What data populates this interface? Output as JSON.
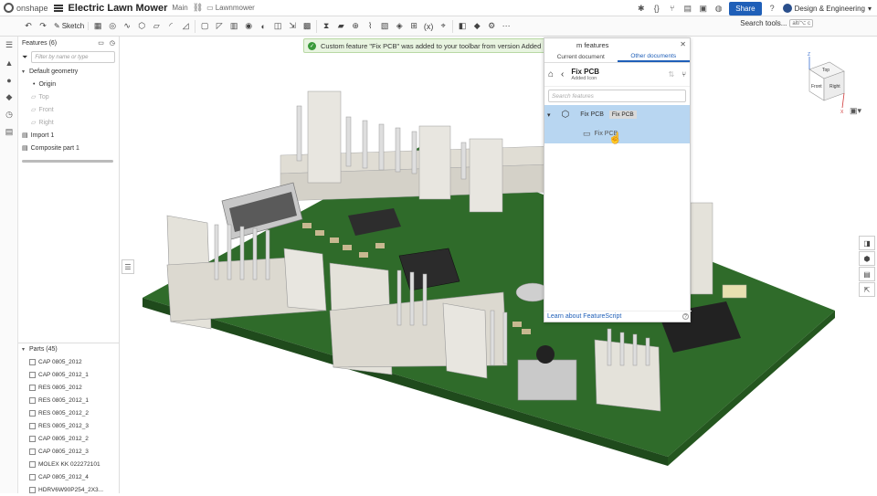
{
  "app": {
    "brand": "onshape",
    "doc_title": "Electric Lawn Mower",
    "branch": "Main",
    "folder": "Lawnmower"
  },
  "topright": {
    "share_label": "Share",
    "user_label": "Design & Engineering"
  },
  "toolbar": {
    "sketch_label": "Sketch",
    "search_label": "Search tools...",
    "search_shortcut": "alt/⌥ c"
  },
  "features": {
    "header": "Features (6)",
    "filter_placeholder": "Filter by name or type",
    "default_geometry": "Default geometry",
    "items": [
      "Origin",
      "Top",
      "Front",
      "Right"
    ],
    "import": "Import 1",
    "composite": "Composite part 1"
  },
  "parts": {
    "header": "Parts (45)",
    "items": [
      "CAP 0805_2012",
      "CAP 0805_2012_1",
      "RES 0805_2012",
      "RES 0805_2012_1",
      "RES 0805_2012_2",
      "RES 0805_2012_3",
      "CAP 0805_2012_2",
      "CAP 0805_2012_3",
      "MOLEX KK 022272101",
      "CAP 0805_2012_4",
      "HDRV6W90P254_2X3..."
    ]
  },
  "toast": {
    "message": "Custom feature \"Fix PCB\" was added to your toolbar from version Added Icon."
  },
  "custom_features": {
    "title_suffix": "m features",
    "tab_current": "Current document",
    "tab_other": "Other documents",
    "nav_title": "Fix PCB",
    "nav_sub": "Added Icon",
    "search_placeholder": "Search features",
    "row1_label": "Fix PCB",
    "row1_badge": "Fix PCB",
    "row2_label": "Fix PCB",
    "footer_link": "Learn about FeatureScript"
  },
  "viewcube": {
    "top": "Top",
    "front": "Front",
    "right": "Right",
    "axis_z": "Z",
    "axis_x": "X"
  },
  "colors": {
    "accent": "#1f5fb8",
    "pcb_green": "#2f6b2a",
    "connector": "#e8e6e0"
  }
}
